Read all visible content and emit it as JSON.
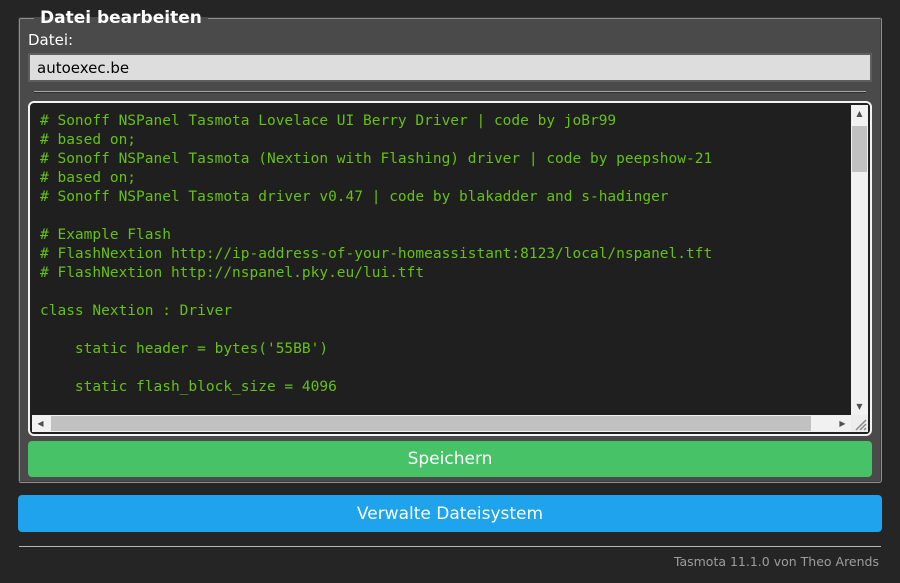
{
  "form": {
    "legend": "Datei bearbeiten",
    "file_label": "Datei:",
    "file_input": {
      "value": "autoexec.be"
    },
    "editor": {
      "code_lines": [
        "# Sonoff NSPanel Tasmota Lovelace UI Berry Driver | code by joBr99",
        "# based on;",
        "# Sonoff NSPanel Tasmota (Nextion with Flashing) driver | code by peepshow-21",
        "# based on;",
        "# Sonoff NSPanel Tasmota driver v0.47 | code by blakadder and s-hadinger",
        "",
        "# Example Flash",
        "# FlashNextion http://ip-address-of-your-homeassistant:8123/local/nspanel.tft",
        "# FlashNextion http://nspanel.pky.eu/lui.tft",
        "",
        "class Nextion : Driver",
        "",
        "    static header = bytes('55BB')",
        "",
        "    static flash_block_size = 4096"
      ]
    },
    "save_button_label": "Speichern"
  },
  "manage_button_label": "Verwalte Dateisystem",
  "footer": {
    "text": "Tasmota 11.1.0 von Theo Arends"
  },
  "icons": {
    "scroll_up": "▲",
    "scroll_down": "▼",
    "scroll_left": "◀",
    "scroll_right": "▶"
  },
  "colors": {
    "page_background": "#252525",
    "form_background": "#4a4a4a",
    "console_background": "#1f1f1f",
    "console_text": "#65c115",
    "input_background": "#dddddd",
    "save_button": "#47c266",
    "action_button": "#1fa3ec",
    "button_text": "#faffff"
  }
}
